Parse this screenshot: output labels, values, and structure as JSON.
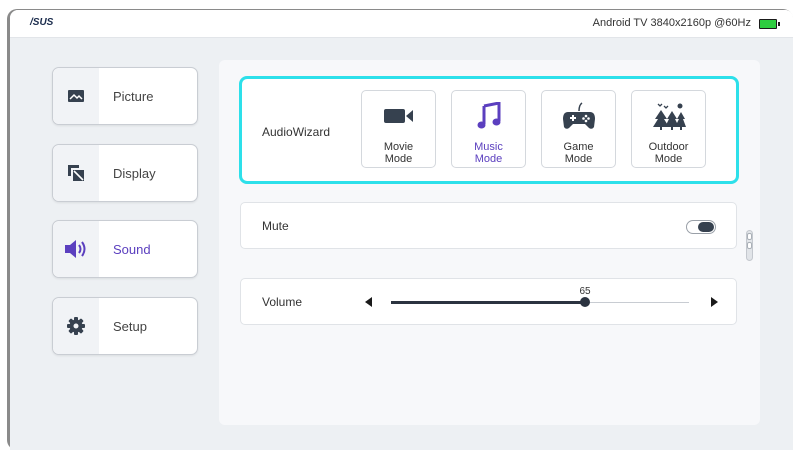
{
  "topbar": {
    "logo": "/SUS",
    "status": "Android TV  3840x2160p @60Hz"
  },
  "sidebar": {
    "items": [
      {
        "label": "Picture",
        "icon": "picture-icon"
      },
      {
        "label": "Display",
        "icon": "display-icon"
      },
      {
        "label": "Sound",
        "icon": "speaker-icon",
        "active": true
      },
      {
        "label": "Setup",
        "icon": "gear-icon"
      }
    ]
  },
  "audio_wizard": {
    "label": "AudioWizard",
    "modes": [
      {
        "line1": "Movie",
        "line2": "Mode",
        "icon": "video-camera-icon"
      },
      {
        "line1": "Music",
        "line2": "Mode",
        "icon": "music-note-icon",
        "selected": true
      },
      {
        "line1": "Game",
        "line2": "Mode",
        "icon": "gamepad-icon"
      },
      {
        "line1": "Outdoor",
        "line2": "Mode",
        "icon": "trees-icon"
      }
    ]
  },
  "mute": {
    "label": "Mute",
    "on": true
  },
  "volume": {
    "label": "Volume",
    "value": "65",
    "level": 0.65
  },
  "colors": {
    "accent": "#5b3fbf",
    "focus": "#2de0ea",
    "battery": "#2ecc40"
  }
}
